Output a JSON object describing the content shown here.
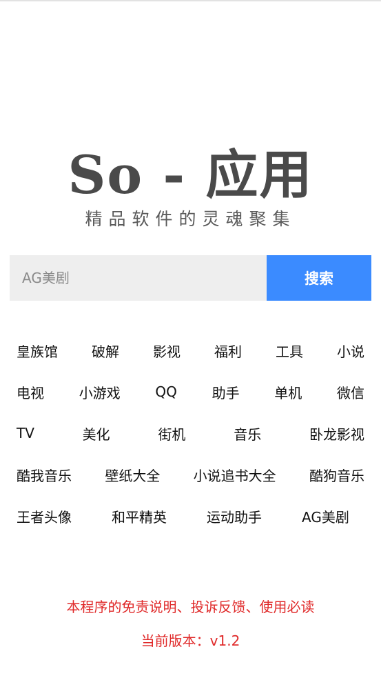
{
  "logo": {
    "title": "So - 应用",
    "subtitle": "精品软件的灵魂聚集"
  },
  "search": {
    "value": "",
    "placeholder": "AG美剧",
    "button_label": "搜索"
  },
  "tags": [
    [
      "皇族馆",
      "破解",
      "影视",
      "福利",
      "工具",
      "小说"
    ],
    [
      "电视",
      "小游戏",
      "QQ",
      "助手",
      "单机",
      "微信"
    ],
    [
      "TV",
      "美化",
      "街机",
      "音乐",
      "卧龙影视"
    ],
    [
      "酷我音乐",
      "壁纸大全",
      "小说追书大全",
      "酷狗音乐"
    ],
    [
      "王者头像",
      "和平精英",
      "运动助手",
      "AG美剧"
    ]
  ],
  "footer": {
    "disclaimer": "本程序的免责说明、投诉反馈、使用必读",
    "version": "当前版本：v1.2"
  },
  "colors": {
    "accent": "#3b8bff",
    "footer_text": "#e02a2a",
    "logo_text": "#4a4a4a"
  }
}
